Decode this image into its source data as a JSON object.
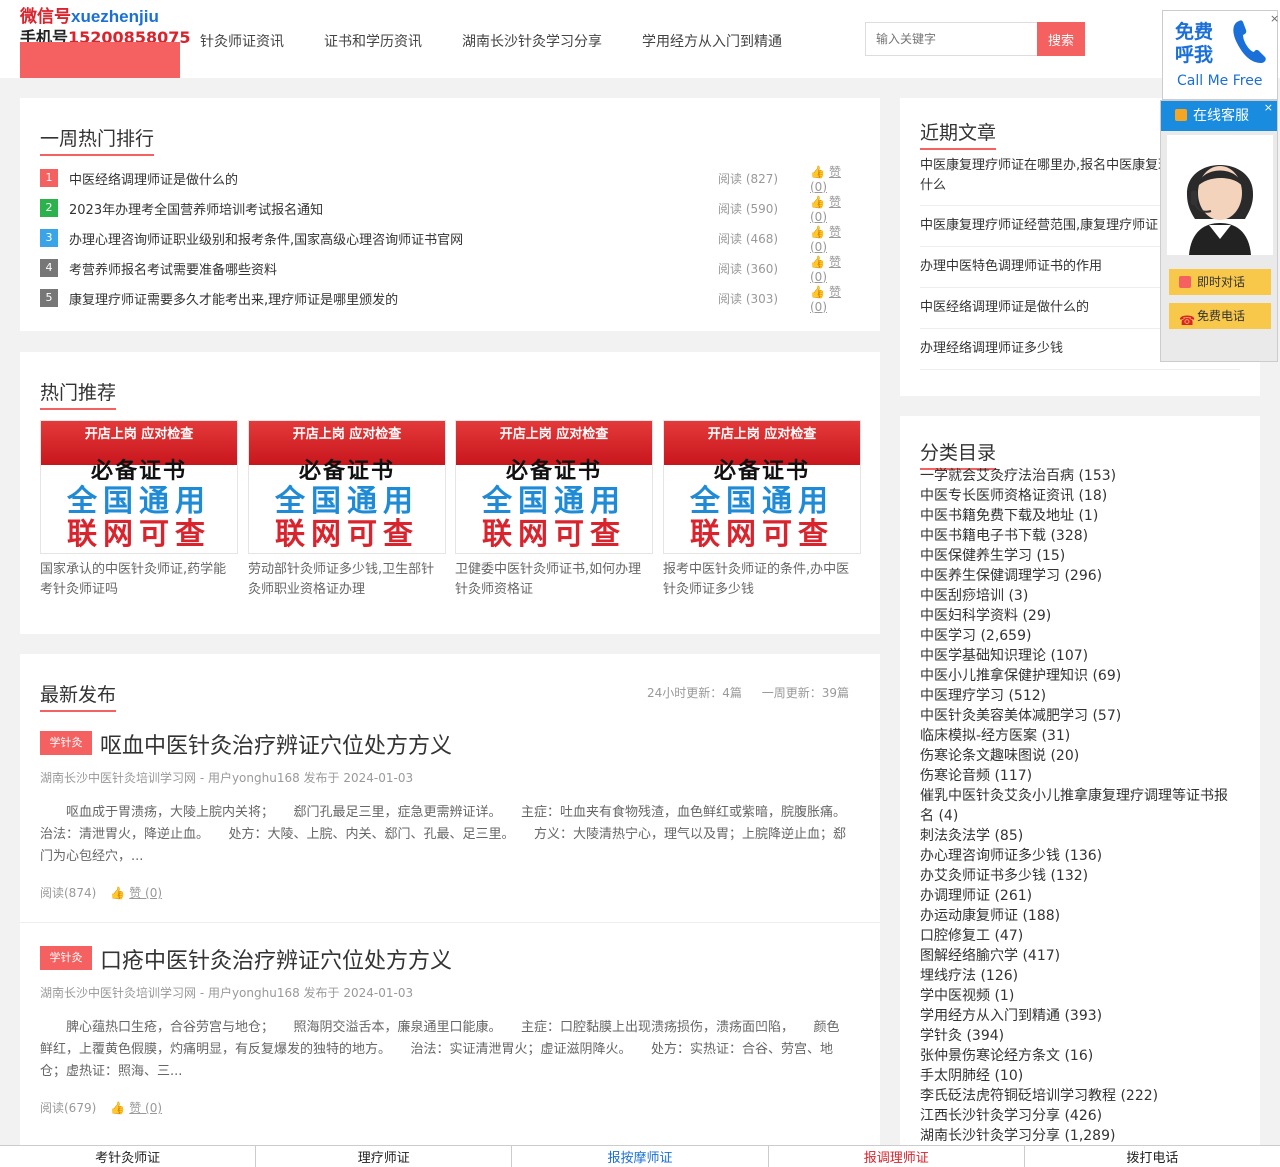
{
  "logo": {
    "line1_cn": "微信号",
    "line1_en": "xuezhenjiu",
    "line2_label": "手机号",
    "line2_number": "15200858075"
  },
  "nav": [
    "针灸师证资讯",
    "证书和学历资讯",
    "湖南长沙针灸学习分享",
    "学用经方从入门到精通"
  ],
  "search": {
    "placeholder": "输入关键字",
    "button": "搜索"
  },
  "weekly_hot": {
    "title": "一周热门排行",
    "items": [
      {
        "n": "1",
        "title": "中医经络调理师证是做什么的",
        "reads": "阅读 (827)",
        "likes": "赞 (0)",
        "color": "#f56060"
      },
      {
        "n": "2",
        "title": "2023年办理考全国营养师培训考试报名通知",
        "reads": "阅读 (590)",
        "likes": "赞 (0)",
        "color": "#2bb24c"
      },
      {
        "n": "3",
        "title": "办理心理咨询师证职业级别和报考条件,国家高级心理咨询师证书官网",
        "reads": "阅读 (468)",
        "likes": "赞 (0)",
        "color": "#3aa4e8"
      },
      {
        "n": "4",
        "title": "考营养师报名考试需要准备哪些资料",
        "reads": "阅读 (360)",
        "likes": "赞 (0)",
        "color": "#777777"
      },
      {
        "n": "5",
        "title": "康复理疗师证需要多久才能考出来,理疗师证是哪里颁发的",
        "reads": "阅读 (303)",
        "likes": "赞 (0)",
        "color": "#777777"
      }
    ]
  },
  "recommend": {
    "title": "热门推荐",
    "image_text": {
      "top": "开店上岗  应对检查",
      "big": "必备证书",
      "blue": "全国通用",
      "red": "联网可查"
    },
    "items": [
      {
        "caption": "国家承认的中医针灸师证,药学能考针灸师证吗"
      },
      {
        "caption": "劳动部针灸师证多少钱,卫生部针灸师职业资格证办理"
      },
      {
        "caption": "卫健委中医针灸师证书,如何办理针灸师资格证"
      },
      {
        "caption": "报考中医针灸师证的条件,办中医针灸师证多少钱"
      }
    ]
  },
  "latest": {
    "title": "最新发布",
    "stats": {
      "day": "24小时更新：4篇",
      "week": "一周更新：39篇"
    },
    "articles": [
      {
        "tag": "学针灸",
        "title": "呕血中医针灸治疗辨证穴位处方方义",
        "meta": "湖南长沙中医针灸培训学习网 - 用户yonghu168 发布于 2024-01-03",
        "desc": "呕血成于胃溃疡，大陵上脘内关将；　　郄门孔最足三里，症急更需辨证详。　　主症：吐血夹有食物残渣，血色鲜红或紫暗，脘腹胀痛。　　治法：清泄胃火，降逆止血。　　处方：大陵、上脘、内关、郄门、孔最、足三里。　　方义：大陵清热宁心，理气以及胃；上脘降逆止血；郄门为心包经穴，...",
        "reads": "阅读(874)",
        "likes": "赞 (0)"
      },
      {
        "tag": "学针灸",
        "title": "口疮中医针灸治疗辨证穴位处方方义",
        "meta": "湖南长沙中医针灸培训学习网 - 用户yonghu168 发布于 2024-01-03",
        "desc": "脾心蕴热口生疮，合谷劳宫与地仓；　　照海阴交溢舌本，廉泉通里口能康。　　主症：口腔黏膜上出现溃疡损伤，溃疡面凹陷，　　颜色鲜红，上覆黄色假膜，灼痛明显，有反复爆发的独特的地方。　　治法：实证清泄胃火；虚证滋阴降火。　　处方：实热证：合谷、劳宫、地仓；虚热证：照海、三...",
        "reads": "阅读(679)",
        "likes": "赞 (0)"
      }
    ]
  },
  "recent": {
    "title": "近期文章",
    "items": [
      "中医康复理疗师证在哪里办,报名中医康复理疗师证是做什么",
      "中医康复理疗师证经营范围,康复理疗师证",
      "办理中医特色调理师证书的作用",
      "中医经络调理师证是做什么的",
      "办理经络调理师证多少钱"
    ]
  },
  "categories": {
    "title": "分类目录",
    "items": [
      "一学就会艾灸疗法治百病 (153)",
      "中医专长医师资格证资讯 (18)",
      "中医书籍免费下载及地址 (1)",
      "中医书籍电子书下载 (328)",
      "中医保健养生学习 (15)",
      "中医养生保健调理学习 (296)",
      "中医刮痧培训 (3)",
      "中医妇科学资料 (29)",
      "中医学习 (2,659)",
      "中医学基础知识理论 (107)",
      "中医小儿推拿保健护理知识 (69)",
      "中医理疗学习 (512)",
      "中医针灸美容美体减肥学习 (57)",
      "临床模拟-经方医案 (31)",
      "伤寒论条文趣味图说 (20)",
      "伤寒论音频 (117)",
      "催乳中医针灸艾灸小儿推拿康复理疗调理等证书报名 (4)",
      "刺法灸法学 (85)",
      "办心理咨询师证多少钱 (136)",
      "办艾灸师证书多少钱 (132)",
      "办调理师证 (261)",
      "办运动康复师证 (188)",
      "口腔修复工 (47)",
      "图解经络腧穴学 (417)",
      "埋线疗法 (126)",
      "学中医视频 (1)",
      "学用经方从入门到精通 (393)",
      "学针灸 (394)",
      "张仲景伤寒论经方条文 (16)",
      "手太阴肺经 (10)",
      "李氏砭法虎符铜砭培训学习教程 (222)",
      "江西长沙针灸学习分享 (426)",
      "湖南长沙针灸学习分享 (1,289)"
    ]
  },
  "callbox": {
    "line1": "免费",
    "line2": "呼我",
    "en": "Call Me Free"
  },
  "kefu": {
    "title": "在线客服",
    "chat": "即时对话",
    "phone": "免费电话"
  },
  "footer": [
    "考针灸师证",
    "理疗师证",
    "报按摩师证",
    "报调理师证",
    "拨打电话"
  ]
}
